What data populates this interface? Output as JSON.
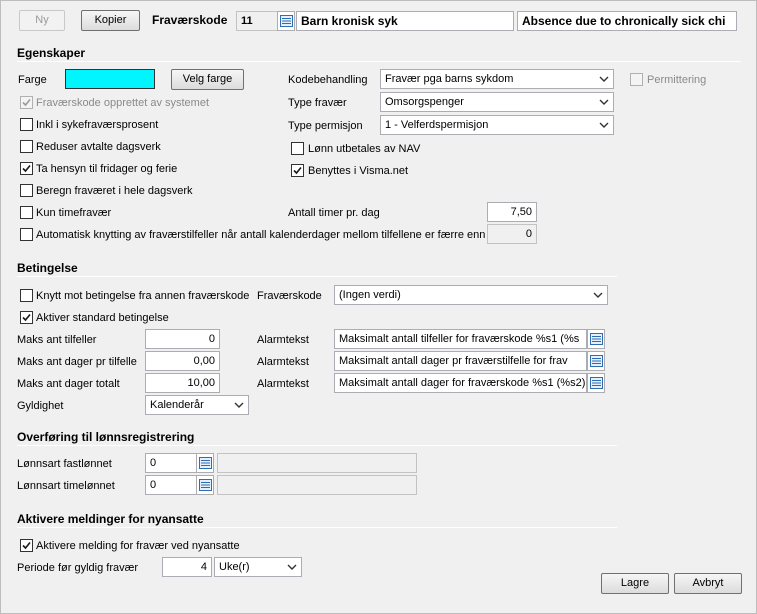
{
  "toolbar": {
    "new_label": "Ny",
    "copy_label": "Kopier",
    "code_label": "Fraværskode",
    "code_value": "11",
    "name_value": "Barn kronisk syk",
    "name_en_value": "Absence due to chronically sick chi"
  },
  "properties": {
    "title": "Egenskaper",
    "color_label": "Farge",
    "color_value": "#00f5ff",
    "choose_color_label": "Velg farge",
    "system_created_label": "Fraværskode opprettet av systemet",
    "sick_percent_label": "Inkl i sykefraværsprosent",
    "reduce_workdays_label": "Reduser avtalte dagsverk",
    "holidays_label": "Ta hensyn til fridager og ferie",
    "whole_days_label": "Beregn fraværet i hele dagsverk",
    "hours_only_label": "Kun timefravær",
    "auto_link_label": "Automatisk knytting av fraværstilfeller når antall kalenderdager mellom tilfellene er færre enn",
    "code_handling_label": "Kodebehandling",
    "code_handling_value": "Fravær pga barns sykdom",
    "layoff_label": "Permittering",
    "absence_type_label": "Type fravær",
    "absence_type_value": "Omsorgspenger",
    "leave_type_label": "Type permisjon",
    "leave_type_value": "1 - Velferdspermisjon",
    "nav_pay_label": "Lønn utbetales av NAV",
    "visma_label": "Benyttes i Visma.net",
    "hours_per_day_label": "Antall timer pr. dag",
    "hours_per_day_value": "7,50",
    "auto_link_value": "0"
  },
  "condition": {
    "title": "Betingelse",
    "link_other_label": "Knytt mot betingelse fra annen fraværskode",
    "code_label": "Fraværskode",
    "code_value": "(Ingen verdi)",
    "standard_label": "Aktiver standard betingelse",
    "max_cases_label": "Maks ant tilfeller",
    "max_cases_value": "0",
    "max_days_case_label": "Maks ant dager pr tilfelle",
    "max_days_case_value": "0,00",
    "max_days_total_label": "Maks ant dager totalt",
    "max_days_total_value": "10,00",
    "validity_label": "Gyldighet",
    "validity_value": "Kalenderår",
    "alarm_label": "Alarmtekst",
    "alarm1_value": "Maksimalt antall tilfeller for fraværskode %s1 (%s",
    "alarm2_value": "Maksimalt antall dager pr fraværstilfelle for frav",
    "alarm3_value": "Maksimalt antall dager for fraværskode %s1 (%s2)"
  },
  "payroll": {
    "title": "Overføring til lønnsregistrering",
    "fixed_label": "Lønnsart fastlønnet",
    "fixed_value": "0",
    "hourly_label": "Lønnsart timelønnet",
    "hourly_value": "0"
  },
  "messages": {
    "title": "Aktivere meldinger for nyansatte",
    "activate_label": "Aktivere melding for fravær ved nyansatte",
    "period_label": "Periode før gyldig fravær",
    "period_value": "4",
    "period_unit": "Uke(r)"
  },
  "footer": {
    "save_label": "Lagre",
    "cancel_label": "Avbryt"
  },
  "icons": {
    "check": "check-mark-icon",
    "lookup": "list-lookup-icon",
    "dropdown": "chevron-down-icon"
  }
}
